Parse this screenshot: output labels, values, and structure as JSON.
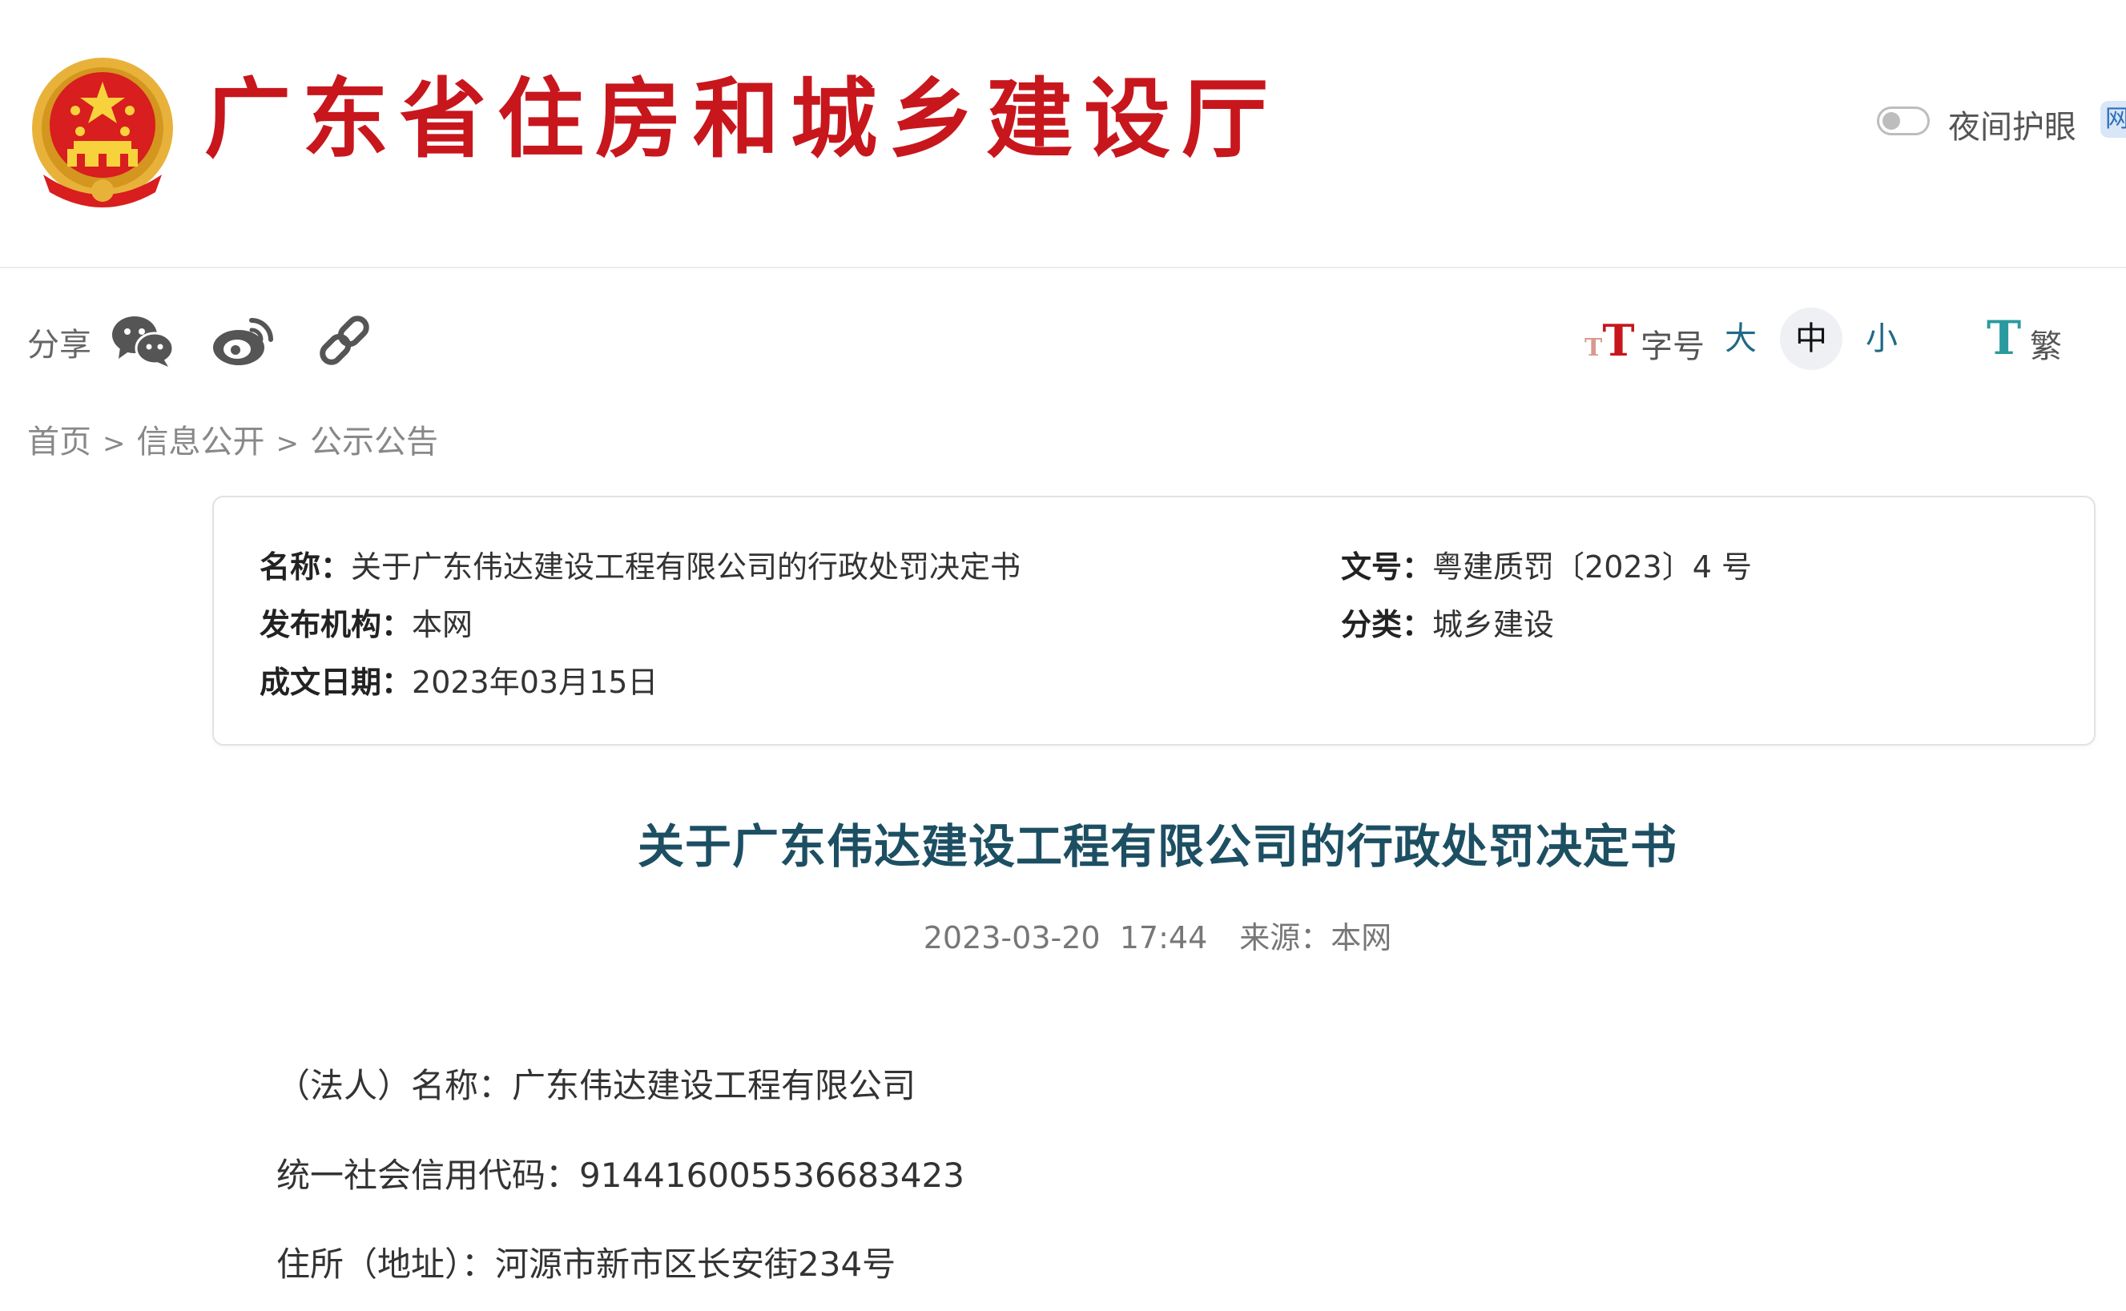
{
  "header": {
    "site_title": "广东省住房和城乡建设厅",
    "night_mode_label": "夜间护眼",
    "edge_badge": "网"
  },
  "toolbar": {
    "share_label": "分享",
    "share_icons": [
      "wechat-icon",
      "weibo-icon",
      "link-icon"
    ],
    "font_size_label": "字号",
    "sizes": [
      "大",
      "中",
      "小"
    ],
    "active_size": "中",
    "traditional_label": "繁"
  },
  "breadcrumb": {
    "items": [
      "首页",
      "信息公开",
      "公示公告"
    ],
    "separator": ">"
  },
  "meta": {
    "name_key": "名称：",
    "name_val": "关于广东伟达建设工程有限公司的行政处罚决定书",
    "publisher_key": "发布机构：",
    "publisher_val": "本网",
    "date_key": "成文日期：",
    "date_val": "2023年03月15日",
    "docno_key": "文号：",
    "docno_val": "粤建质罚〔2023〕4 号",
    "category_key": "分类：",
    "category_val": "城乡建设"
  },
  "article": {
    "title": "关于广东伟达建设工程有限公司的行政处罚决定书",
    "date": "2023-03-20",
    "time": "17:44",
    "source": "来源：本网",
    "paragraphs": [
      "（法人）名称：广东伟达建设工程有限公司",
      "统一社会信用代码：914416005536683423",
      "住所（地址）：河源市新市区长安街234号"
    ]
  },
  "colors": {
    "brand_red": "#c8161d",
    "title_teal": "#1d4f63",
    "link_teal": "#1f6a86"
  }
}
